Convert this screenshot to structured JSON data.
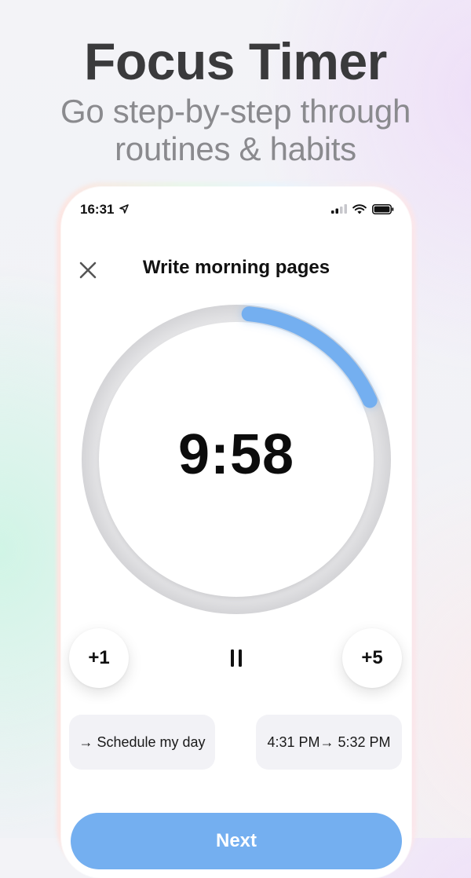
{
  "promo": {
    "headline": "Focus Timer",
    "subheadline_line1": "Go step-by-step through",
    "subheadline_line2": "routines & habits"
  },
  "status_bar": {
    "time": "16:31",
    "location_icon": "location-arrow-icon",
    "signal_icon": "cellular-signal-icon",
    "wifi_icon": "wifi-icon",
    "battery_icon": "battery-icon"
  },
  "task": {
    "title": "Write morning pages",
    "close_icon": "close-icon"
  },
  "timer": {
    "display": "9:58",
    "progress_fraction": 0.17,
    "accent_color": "#74aff0"
  },
  "controls": {
    "add_one_label": "+1",
    "add_five_label": "+5",
    "pause_icon": "pause-icon"
  },
  "chips": {
    "next_task": "→ Schedule my day",
    "time_range": "4:31 PM→ 5:32 PM"
  },
  "next_button": {
    "label": "Next",
    "color": "#74aff0"
  }
}
